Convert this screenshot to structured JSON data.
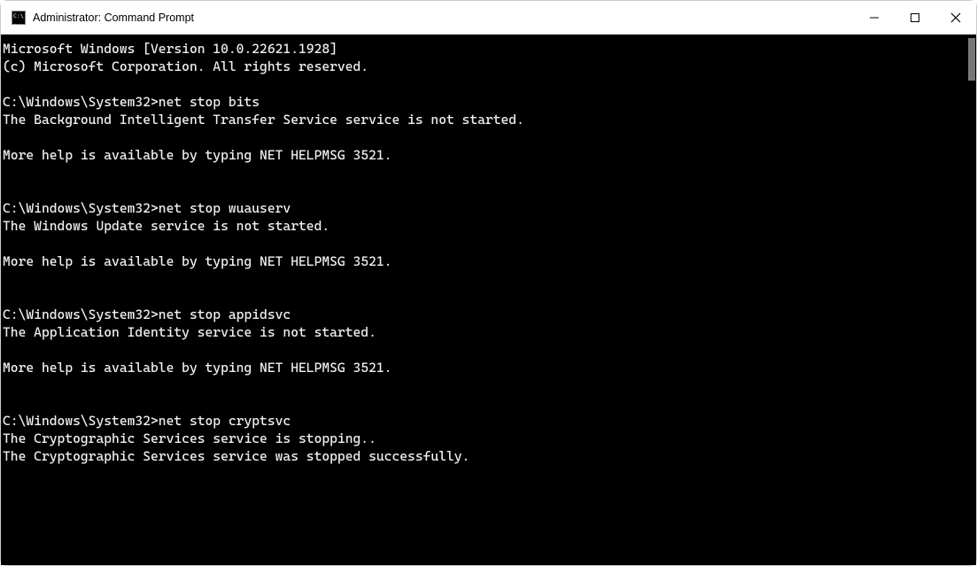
{
  "window": {
    "title": "Administrator: Command Prompt"
  },
  "terminal": {
    "lines": [
      "Microsoft Windows [Version 10.0.22621.1928]",
      "(c) Microsoft Corporation. All rights reserved.",
      "",
      "C:\\Windows\\System32>net stop bits",
      "The Background Intelligent Transfer Service service is not started.",
      "",
      "More help is available by typing NET HELPMSG 3521.",
      "",
      "",
      "C:\\Windows\\System32>net stop wuauserv",
      "The Windows Update service is not started.",
      "",
      "More help is available by typing NET HELPMSG 3521.",
      "",
      "",
      "C:\\Windows\\System32>net stop appidsvc",
      "The Application Identity service is not started.",
      "",
      "More help is available by typing NET HELPMSG 3521.",
      "",
      "",
      "C:\\Windows\\System32>net stop cryptsvc",
      "The Cryptographic Services service is stopping..",
      "The Cryptographic Services service was stopped successfully.",
      "",
      ""
    ]
  }
}
